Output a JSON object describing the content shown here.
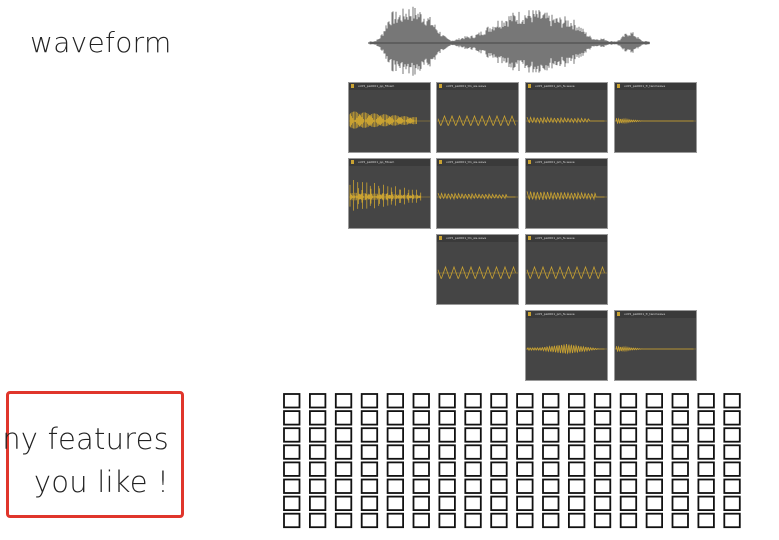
{
  "title": "waveform",
  "callout": {
    "line1": "any features",
    "line2": "you like !"
  },
  "panels": [
    {
      "caption": "vc05_pa0001_pp_fitosm",
      "col": 0,
      "row": 0,
      "style": "dense"
    },
    {
      "caption": "vc05_pa0001_tm_ws-wave",
      "col": 1,
      "row": 0,
      "style": "tri"
    },
    {
      "caption": "vc05_pa0001_pm_fs-wave",
      "col": 2,
      "row": 0,
      "style": "comb"
    },
    {
      "caption": "vc05_pa0001_fr_tanmwave",
      "col": 3,
      "row": 0,
      "style": "decay"
    },
    {
      "caption": "vc05_pa0001_pp_fitosm",
      "col": 0,
      "row": 1,
      "style": "spikes"
    },
    {
      "caption": "vc05_pa0001_tm_ws-wave",
      "col": 1,
      "row": 1,
      "style": "comb2"
    },
    {
      "caption": "vc05_pa0001_pm_fs-wave",
      "col": 2,
      "row": 1,
      "style": "saw"
    },
    {
      "caption": "vc05_pa0001_tm_ws-wave",
      "col": 1,
      "row": 2,
      "style": "tri2"
    },
    {
      "caption": "vc05_pa0001_pm_fs-wave",
      "col": 2,
      "row": 2,
      "style": "tri3"
    },
    {
      "caption": "vc05_pa0001_pm_fs-wave",
      "col": 2,
      "row": 3,
      "style": "late"
    },
    {
      "caption": "vc05_pa0001_fr_tanmwave",
      "col": 3,
      "row": 3,
      "style": "decay2"
    }
  ],
  "feature_grid": {
    "columns": 18,
    "rows": 8
  },
  "colors": {
    "panel_bg": "#454545",
    "wave_gold": "#c9a232",
    "callout_border": "#e0352b",
    "grid_stroke": "#111111"
  }
}
